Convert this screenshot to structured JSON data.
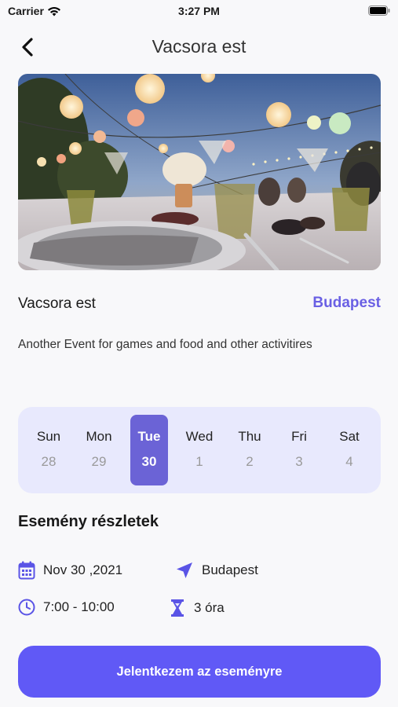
{
  "status_bar": {
    "carrier": "Carrier",
    "time": "3:27 PM"
  },
  "nav": {
    "title": "Vacsora est",
    "back_icon": "chevron-left-icon"
  },
  "hero": {
    "image": "dinner-table-with-lanterns"
  },
  "event": {
    "title": "Vacsora est",
    "city": "Budapest",
    "description": "Another Event for games and food and other activitires"
  },
  "week": {
    "days": [
      {
        "name": "Sun",
        "date": "28"
      },
      {
        "name": "Mon",
        "date": "29"
      },
      {
        "name": "Tue",
        "date": "30"
      },
      {
        "name": "Wed",
        "date": "1"
      },
      {
        "name": "Thu",
        "date": "2"
      },
      {
        "name": "Fri",
        "date": "3"
      },
      {
        "name": "Sat",
        "date": "4"
      }
    ],
    "selected_index": 2
  },
  "details": {
    "section_title": "Esemény részletek",
    "date": "Nov 30 ,2021",
    "location": "Budapest",
    "time": "7:00 - 10:00",
    "duration": "3 óra"
  },
  "cta": {
    "label": "Jelentkezem az eseményre"
  },
  "colors": {
    "accent": "#6059f6",
    "selected_day": "#6b63d6",
    "week_bg": "#e8e9fd",
    "city": "#6a60e4"
  }
}
